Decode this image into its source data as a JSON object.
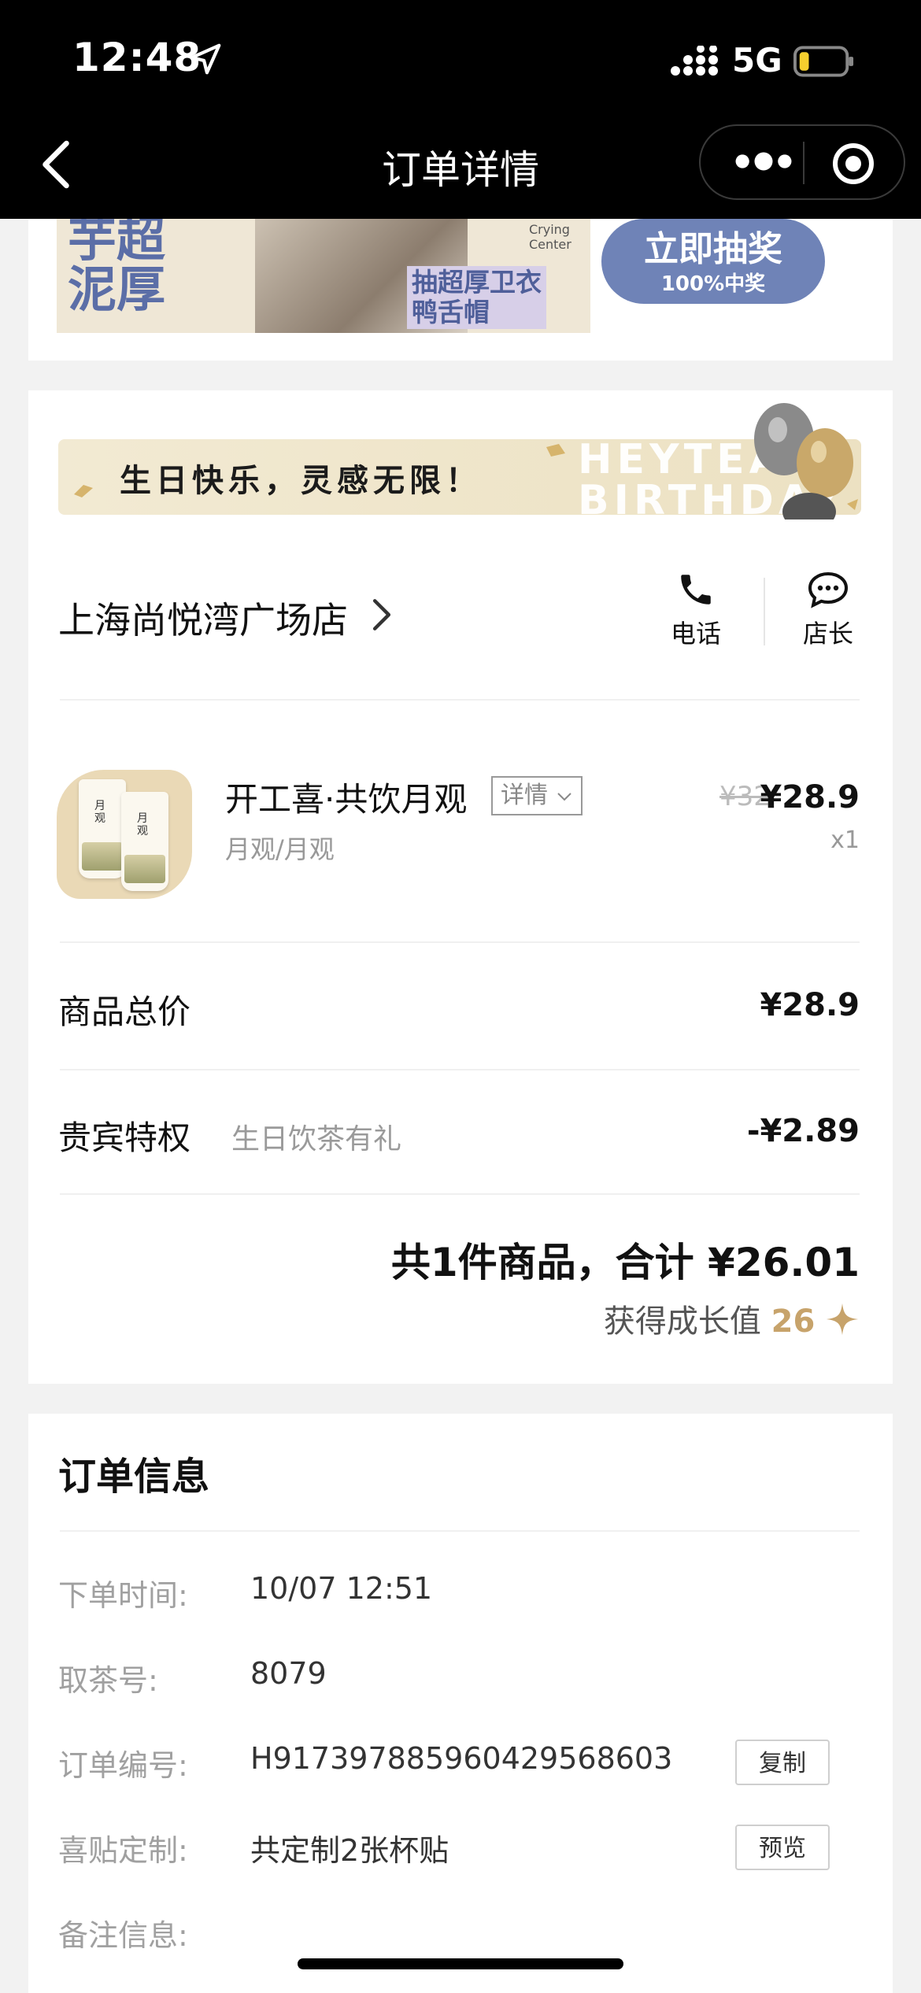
{
  "status_bar": {
    "time": "12:48",
    "network": "5G"
  },
  "nav": {
    "title": "订单详情"
  },
  "banner": {
    "ad_text": "芋超\n泥厚",
    "ad_sub": "抽超厚卫衣\n鸭舌帽",
    "ad_logo": "Crying Center",
    "draw_label": "立即抽奖",
    "draw_sub": "100%中奖"
  },
  "birthday": {
    "text": "生日快乐，灵感无限！",
    "en_text": "HEYTEA\nBIRTHDAY"
  },
  "store": {
    "name": "上海尚悦湾广场店",
    "phone_label": "电话",
    "manager_label": "店长"
  },
  "product": {
    "cup_label": "月\n观",
    "name": "开工喜·共饮月观",
    "detail_label": "详情",
    "variant": "月观/月观",
    "original_price": "¥32",
    "price": "¥28.9",
    "quantity": "x1"
  },
  "summary": {
    "subtotal_label": "商品总价",
    "subtotal_value": "¥28.9",
    "vip_label": "贵宾特权",
    "vip_desc": "生日饮茶有礼",
    "vip_value": "-¥2.89",
    "total_text": "共1件商品，合计",
    "total_value": "¥26.01",
    "growth_label": "获得成长值",
    "growth_value": "26"
  },
  "order_info": {
    "title": "订单信息",
    "rows": [
      {
        "label": "下单时间:",
        "value": "10/07 12:51"
      },
      {
        "label": "取茶号:",
        "value": "8079"
      },
      {
        "label": "订单编号:",
        "value": "H917397885960429568603",
        "button": "复制"
      },
      {
        "label": "喜贴定制:",
        "value": "共定制2张杯贴",
        "button": "预览"
      },
      {
        "label": "备注信息:",
        "value": ""
      }
    ]
  },
  "colors": {
    "accent_gold": "#c7a36b",
    "ad_blue": "#6f83b7"
  }
}
